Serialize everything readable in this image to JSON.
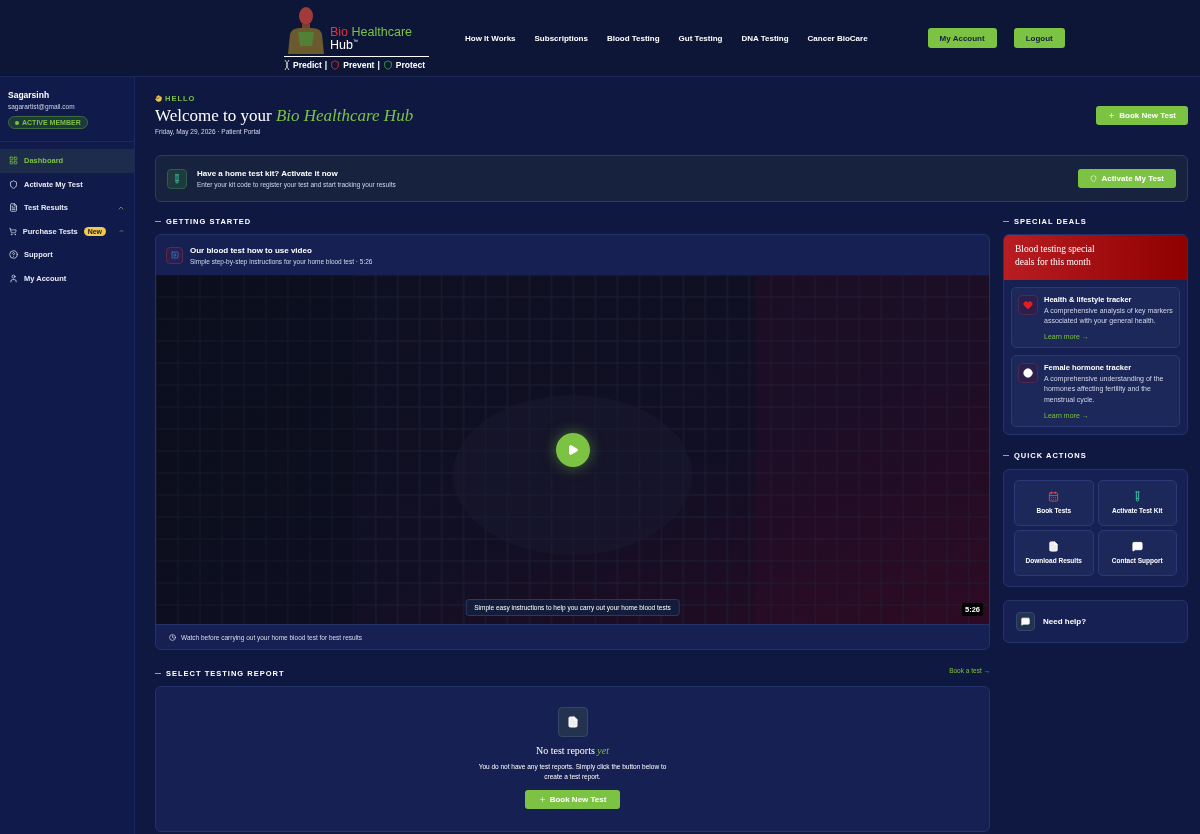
{
  "header": {
    "logo": {
      "word_1": "Bio",
      "word_2": "Healthcare",
      "word_3": "Hub",
      "trademark": "™",
      "taglines": [
        "Predict",
        "Prevent",
        "Protect"
      ],
      "separator": "|"
    },
    "nav": [
      "How It Works",
      "Subscriptions",
      "Blood Testing",
      "Gut Testing",
      "DNA Testing",
      "Cancer BioCare"
    ],
    "buttons": [
      "My Account",
      "Logout"
    ]
  },
  "sidebar": {
    "user": {
      "name": "Sagarsinh",
      "email": "sagarartist@gmail.com",
      "badge": "ACTIVE MEMBER"
    },
    "items": [
      {
        "label": "Dashboard",
        "selected": true,
        "has_submenu": false
      },
      {
        "label": "Activate My Test",
        "selected": false,
        "has_submenu": false
      },
      {
        "label": "Test Results",
        "selected": false,
        "has_submenu": true
      },
      {
        "label": "Purchase Tests",
        "selected": false,
        "has_submenu": true,
        "badge": "New"
      },
      {
        "label": "Support",
        "selected": false,
        "has_submenu": false
      },
      {
        "label": "My Account",
        "selected": false,
        "has_submenu": false
      }
    ]
  },
  "greeting": {
    "eyebrow": "HELLO",
    "title": "Welcome to your *Bio Healthcare Hub*",
    "subtitle": "Friday, May 29, 2026 · Patient Portal",
    "button": "Book New Test"
  },
  "activation": {
    "title": "Have a home test kit? Activate it now",
    "text": "Enter your kit code to register your test and start tracking your results",
    "button": "Activate My Test"
  },
  "getting_started": {
    "heading": "GETTING STARTED",
    "video": {
      "title": "Our blood test how to use video",
      "subtitle": "Simple step-by-step instructions for your home blood test · 5:26",
      "caption": "Simple easy instructions to help you carry out your home blood tests",
      "duration": "5:26",
      "note": "Watch before carrying out your home blood test for best results"
    }
  },
  "reports": {
    "heading": "SELECT TESTING REPORT",
    "link": "Book a test →",
    "empty_title": "No test reports *yet*",
    "empty_text": "You do not have any test reports. Simply click the button below to create a test report.",
    "button": "Book New Test"
  },
  "special_deals": {
    "heading": "SPECIAL DEALS",
    "title": "Blood testing special deals for this month",
    "deals": [
      {
        "title": "Health & lifestyle tracker",
        "text": "A comprehensive analysis of key markers associated with your general health.",
        "link": "Learn more →"
      },
      {
        "title": "Female hormone tracker",
        "text": "A comprehensive understanding of the hormones affecting fertility and the menstrual cycle.",
        "link": "Learn more →"
      }
    ]
  },
  "quick_actions": {
    "heading": "QUICK ACTIONS",
    "actions": [
      "Book Tests",
      "Activate Test Kit",
      "Download Results",
      "Contact Support"
    ]
  },
  "help": {
    "label": "Need help?"
  }
}
